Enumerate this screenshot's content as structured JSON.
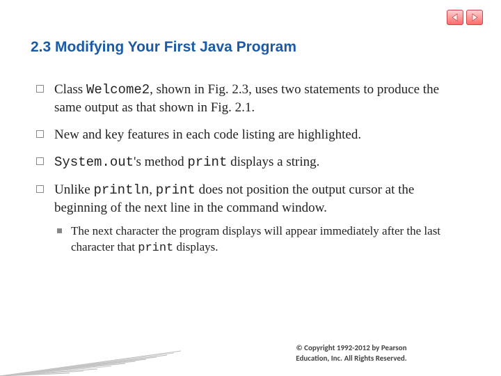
{
  "heading": "2.3  Modifying Your First Java Program",
  "bullets": {
    "b1_pre": "Class ",
    "b1_code": "Welcome2",
    "b1_post": ", shown in Fig. 2.3, uses two statements to produce the same output as that shown in Fig. 2.1.",
    "b2": "New and key features in each code listing are highlighted.",
    "b3_code1": "System.out",
    "b3_mid": "'s method ",
    "b3_code2": "print",
    "b3_post": " displays a string.",
    "b4_pre": "Unlike ",
    "b4_code1": "println",
    "b4_mid": ", ",
    "b4_code2": "print",
    "b4_post": " does not position the output cursor at the beginning of the next line in the command window.",
    "sub_pre": "The next character the program displays will appear immediately after the last character that ",
    "sub_code": "print",
    "sub_post": " displays."
  },
  "footer_line1": "© Copyright 1992-2012 by Pearson",
  "footer_line2": "Education, Inc. All Rights Reserved."
}
